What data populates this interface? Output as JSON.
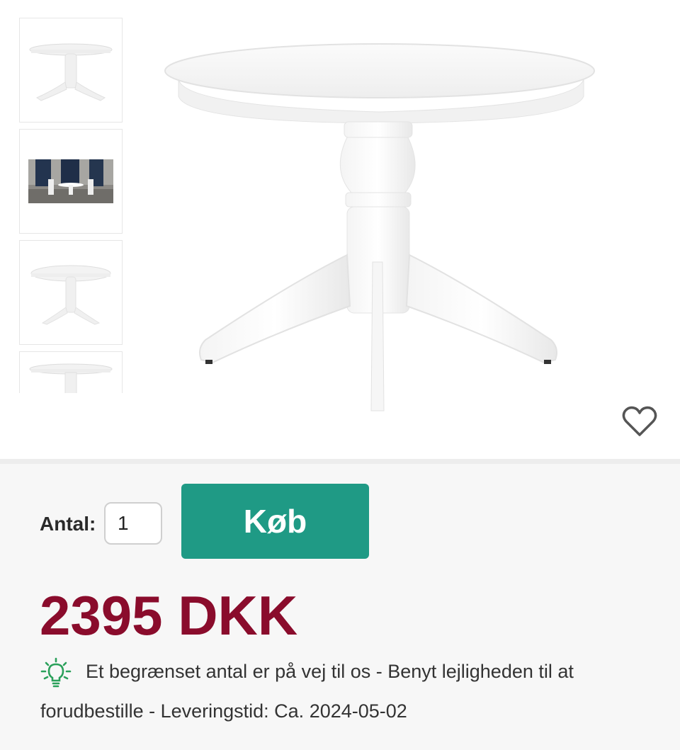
{
  "gallery": {
    "thumbnails": [
      {
        "icon": "table-thumbnail-white"
      },
      {
        "icon": "room-scene-thumbnail"
      },
      {
        "icon": "table-thumbnail-white-angle"
      },
      {
        "icon": "table-thumbnail-partial"
      }
    ],
    "main_image": {
      "icon": "round-pedestal-table-image"
    },
    "favorite": {
      "icon": "heart-icon"
    }
  },
  "purchase": {
    "quantity_label": "Antal:",
    "quantity_value": "1",
    "buy_label": "Køb",
    "price": "2395 DKK",
    "notice_icon": "lightbulb-icon",
    "notice_line1": "Et begrænset antal er på vej til os - Benyt lejligheden til at",
    "notice_line2": "forudbestille - Leveringstid: Ca. 2024-05-02"
  },
  "colors": {
    "buy_button": "#1f9a85",
    "price": "#8a0c2c",
    "notice_icon": "#2aa05a"
  }
}
